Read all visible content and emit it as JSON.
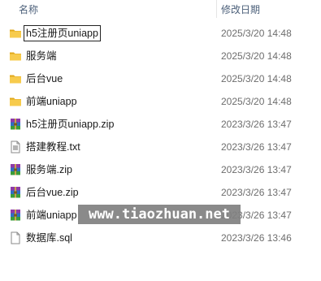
{
  "header": {
    "name_label": "名称",
    "date_label": "修改日期"
  },
  "files": [
    {
      "name": "h5注册页uniapp",
      "date": "2025/3/20 14:48",
      "icon": "folder-icon",
      "selected": true
    },
    {
      "name": "服务端",
      "date": "2025/3/20 14:48",
      "icon": "folder-icon",
      "selected": false
    },
    {
      "name": "后台vue",
      "date": "2025/3/20 14:48",
      "icon": "folder-icon",
      "selected": false
    },
    {
      "name": "前端uniapp",
      "date": "2025/3/20 14:48",
      "icon": "folder-icon",
      "selected": false
    },
    {
      "name": "h5注册页uniapp.zip",
      "date": "2023/3/26 13:47",
      "icon": "winrar-archive-icon",
      "selected": false
    },
    {
      "name": "搭建教程.txt",
      "date": "2023/3/26 13:47",
      "icon": "text-file-icon",
      "selected": false
    },
    {
      "name": "服务端.zip",
      "date": "2023/3/26 13:47",
      "icon": "winrar-archive-icon",
      "selected": false
    },
    {
      "name": "后台vue.zip",
      "date": "2023/3/26 13:47",
      "icon": "winrar-archive-icon",
      "selected": false
    },
    {
      "name": "前端uniapp",
      "date": "2023/3/26 13:47",
      "icon": "winrar-archive-icon",
      "selected": false
    },
    {
      "name": "数据库.sql",
      "date": "2023/3/26 13:46",
      "icon": "file-icon",
      "selected": false
    }
  ],
  "watermark": "www.tiaozhuan.net",
  "colors": {
    "folder": "#f4c542",
    "header_text": "#4c607a",
    "date_text": "#6d6d6d"
  }
}
